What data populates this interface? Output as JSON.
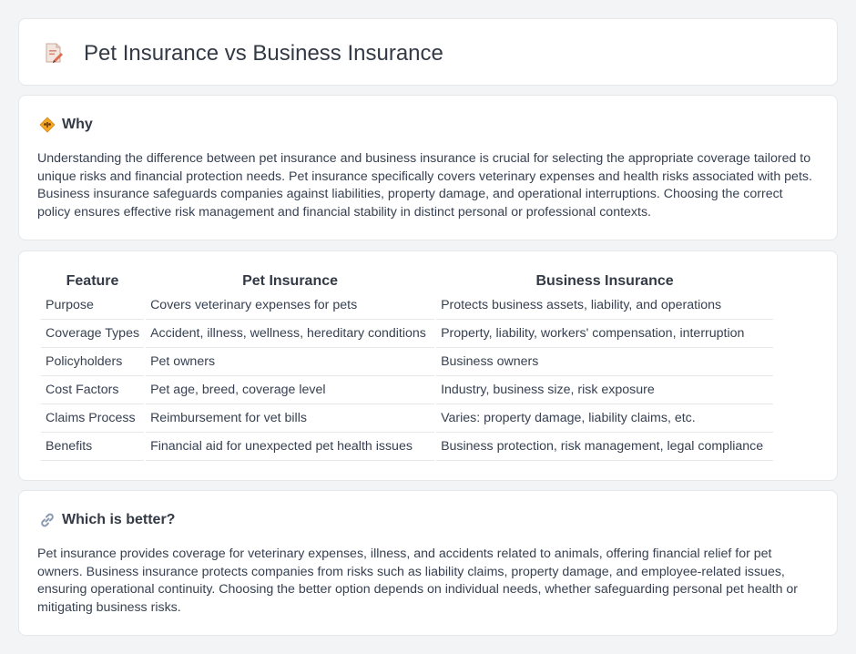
{
  "header": {
    "title": "Pet Insurance vs Business Insurance",
    "icon": "document-pencil-icon"
  },
  "why": {
    "title": "Why",
    "icon": "diamond-sign-icon",
    "text": "Understanding the difference between pet insurance and business insurance is crucial for selecting the appropriate coverage tailored to unique risks and financial protection needs. Pet insurance specifically covers veterinary expenses and health risks associated with pets. Business insurance safeguards companies against liabilities, property damage, and operational interruptions. Choosing the correct policy ensures effective risk management and financial stability in distinct personal or professional contexts."
  },
  "table": {
    "headers": [
      "Feature",
      "Pet Insurance",
      "Business Insurance"
    ],
    "rows": [
      [
        "Purpose",
        "Covers veterinary expenses for pets",
        "Protects business assets, liability, and operations"
      ],
      [
        "Coverage Types",
        "Accident, illness, wellness, hereditary conditions",
        "Property, liability, workers' compensation, interruption"
      ],
      [
        "Policyholders",
        "Pet owners",
        "Business owners"
      ],
      [
        "Cost Factors",
        "Pet age, breed, coverage level",
        "Industry, business size, risk exposure"
      ],
      [
        "Claims Process",
        "Reimbursement for vet bills",
        "Varies: property damage, liability claims, etc."
      ],
      [
        "Benefits",
        "Financial aid for unexpected pet health issues",
        "Business protection, risk management, legal compliance"
      ]
    ]
  },
  "better": {
    "title": "Which is better?",
    "icon": "link-icon",
    "text": "Pet insurance provides coverage for veterinary expenses, illness, and accidents related to animals, offering financial relief for pet owners. Business insurance protects companies from risks such as liability claims, property damage, and employee-related issues, ensuring operational continuity. Choosing the better option depends on individual needs, whether safeguarding personal pet health or mitigating business risks."
  }
}
